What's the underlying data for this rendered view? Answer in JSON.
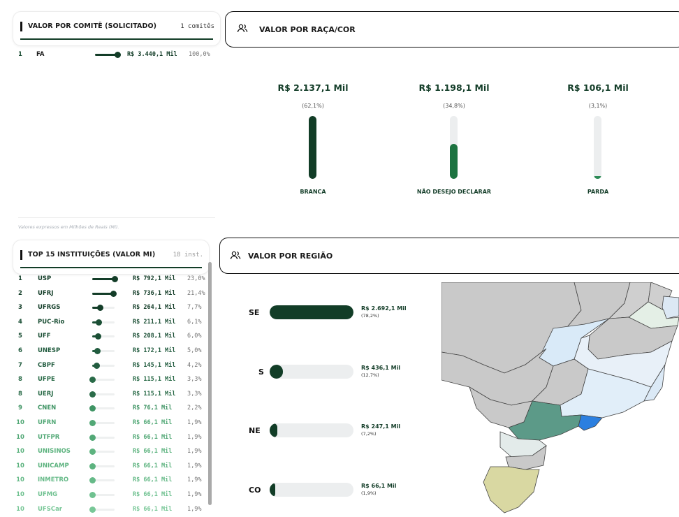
{
  "comite": {
    "title": "VALOR POR COMITÊ (SOLICITADO)",
    "count": "1 comitês",
    "rows": [
      {
        "rank": "1",
        "name": "FA",
        "value": "R$ 3.440,1 Mil",
        "pct": "100,0%",
        "share": 1.0
      }
    ]
  },
  "note": "Valores expressos em Milhões de Reais (Mi).",
  "raca": {
    "title": "VALOR POR RAÇA/COR",
    "items": [
      {
        "value": "R$ 2.137,1 Mil",
        "pct": "(62,1%)",
        "label": "BRANCA",
        "share": 1.0,
        "color": "#123d27"
      },
      {
        "value": "R$ 1.198,1 Mil",
        "pct": "(34,8%)",
        "label": "NÃO DESEJO DECLARAR",
        "share": 0.56,
        "color": "#1c7340"
      },
      {
        "value": "R$ 106,1 Mil",
        "pct": "(3,1%)",
        "label": "PARDA",
        "share": 0.05,
        "color": "#2e8b57"
      }
    ]
  },
  "instituicoes": {
    "title": "TOP 15 INSTITUIÇÕES (VALOR MI)",
    "count": "18 inst.",
    "rows": [
      {
        "rank": "1",
        "name": "USP",
        "value": "R$ 792,1 Mil",
        "pct": "23,0%",
        "share": 1.0,
        "tone": "#133d28"
      },
      {
        "rank": "2",
        "name": "UFRJ",
        "value": "R$ 736,1 Mil",
        "pct": "21,4%",
        "share": 0.93,
        "tone": "#133d28"
      },
      {
        "rank": "3",
        "name": "UFRGS",
        "value": "R$ 264,1 Mil",
        "pct": "7,7%",
        "share": 0.33,
        "tone": "#133d28"
      },
      {
        "rank": "4",
        "name": "PUC-Rio",
        "value": "R$ 211,1 Mil",
        "pct": "6,1%",
        "share": 0.27,
        "tone": "#1b4f35"
      },
      {
        "rank": "5",
        "name": "UFF",
        "value": "R$ 208,1 Mil",
        "pct": "6,0%",
        "share": 0.26,
        "tone": "#1b4f35"
      },
      {
        "rank": "6",
        "name": "UNESP",
        "value": "R$ 172,1 Mil",
        "pct": "5,0%",
        "share": 0.22,
        "tone": "#225c3f"
      },
      {
        "rank": "7",
        "name": "CBPF",
        "value": "R$ 145,1 Mil",
        "pct": "4,2%",
        "share": 0.18,
        "tone": "#225c3f"
      },
      {
        "rank": "8",
        "name": "UFPE",
        "value": "R$ 115,1 Mil",
        "pct": "3,3%",
        "share": 0.0,
        "tone": "#2a6b48"
      },
      {
        "rank": "8",
        "name": "UERJ",
        "value": "R$ 115,1 Mil",
        "pct": "3,3%",
        "share": 0.0,
        "tone": "#2a6b48"
      },
      {
        "rank": "9",
        "name": "CNEN",
        "value": "R$ 76,1 Mil",
        "pct": "2,2%",
        "share": 0.0,
        "tone": "#3f9464"
      },
      {
        "rank": "10",
        "name": "UFRN",
        "value": "R$ 66,1 Mil",
        "pct": "1,9%",
        "share": 0.0,
        "tone": "#52a876"
      },
      {
        "rank": "10",
        "name": "UTFPR",
        "value": "R$ 66,1 Mil",
        "pct": "1,9%",
        "share": 0.0,
        "tone": "#52a876"
      },
      {
        "rank": "10",
        "name": "UNISINOS",
        "value": "R$ 66,1 Mil",
        "pct": "1,9%",
        "share": 0.0,
        "tone": "#5db37f"
      },
      {
        "rank": "10",
        "name": "UNICAMP",
        "value": "R$ 66,1 Mil",
        "pct": "1,9%",
        "share": 0.0,
        "tone": "#5db37f"
      },
      {
        "rank": "10",
        "name": "INMETRO",
        "value": "R$ 66,1 Mil",
        "pct": "1,9%",
        "share": 0.0,
        "tone": "#66ba88"
      },
      {
        "rank": "10",
        "name": "UFMG",
        "value": "R$ 66,1 Mil",
        "pct": "1,9%",
        "share": 0.0,
        "tone": "#6fc190"
      },
      {
        "rank": "10",
        "name": "UFSCar",
        "value": "R$ 66,1 Mil",
        "pct": "1,9%",
        "share": 0.0,
        "tone": "#78c797"
      }
    ]
  },
  "regiao": {
    "title": "VALOR POR REGIÃO",
    "items": [
      {
        "code": "SE",
        "value": "R$ 2.692,1 Mil",
        "pct": "(78,2%)",
        "share": 1.0
      },
      {
        "code": "S",
        "value": "R$ 436,1 Mil",
        "pct": "(12,7%)",
        "share": 0.16
      },
      {
        "code": "NE",
        "value": "R$ 247,1 Mil",
        "pct": "(7,2%)",
        "share": 0.09
      },
      {
        "code": "CO",
        "value": "R$ 66,1 Mil",
        "pct": "(1,9%)",
        "share": 0.025
      }
    ]
  },
  "icons": {
    "people": "people-icon"
  }
}
